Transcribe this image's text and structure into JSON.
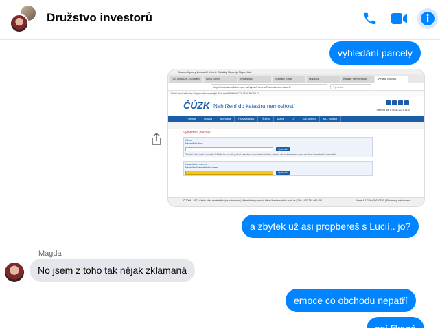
{
  "header": {
    "title": "Družstvo investorů",
    "phone_icon": "phone-icon",
    "video_icon": "video-icon",
    "info_icon": "info-icon",
    "accent": "#0084ff"
  },
  "messages": [
    {
      "id": "m1",
      "dir": "out",
      "text": "vyhledání parcely"
    },
    {
      "id": "m2",
      "dir": "out",
      "type": "image"
    },
    {
      "id": "m3",
      "dir": "out",
      "text": "a zbytek už asi propbereš s Lucií.. jo?"
    },
    {
      "id": "m4",
      "dir": "in",
      "sender": "Magda",
      "text": "No jsem z toho tak nějak zklamaná"
    },
    {
      "id": "m5",
      "dir": "out",
      "text": "emoce co obchodu nepatří"
    },
    {
      "id": "m6",
      "dir": "out",
      "text": "ani fikaná"
    }
  ],
  "screenshot": {
    "menubar": "Soubor  Úpravy  Zobrazit  Historie  Záložky  Nástroje  Nápověda",
    "tabs": [
      "(34) Diskuze - Seznam",
      "Nový panel",
      "WhatsApp",
      "Seznam Email",
      "Mapy.cz",
      "Katastr nemovitostí",
      "Vyhled. parcely"
    ],
    "url": "https://nahlizenidokn.cuzk.cz/VyberParcelu/Parcela/InformaceO",
    "search_placeholder": "Vyhledat",
    "bookmarks": "Nahlížení záložky   Nejnavštěvovanější   Jak začít   FINANCOVÁNÍ BYTU 2...",
    "logo": "ČÚZK",
    "logo_sub": "Nahlížení do katastru nemovitostí",
    "date": "Platnost dat k 09.08.2021 13:00",
    "nav": [
      "Parcela",
      "Stavba",
      "Jednotka",
      "Práva stavby",
      "Řízení",
      "Mapa",
      "LV",
      "Kat. území",
      "MO, katastr"
    ],
    "heading": "Vyhledání parcely",
    "box1_label": "Obec",
    "box1_field": "Název/kód obce:",
    "box1_button": "Vyhledat",
    "box1_note": "Zadání obce není povinné. Můžete ho použít, pokud neznáte název katastrálního území, ale znáte název obce, ve které katastrální území leží.",
    "box2_label": "Katastrální území",
    "box2_field": "Název/kód katastrálního území",
    "box2_button": "Vyhledat",
    "footer_left": "© 2004 - 2021 Český úřad zeměměřický a katastrální | Vyhledávání pomocí: https://nahlizenidokn.cuzk.cz | Tel.: +420 284 044 450",
    "footer_right": "Verze 6.1.2.60 (20210330) | Podmínky a informace"
  }
}
